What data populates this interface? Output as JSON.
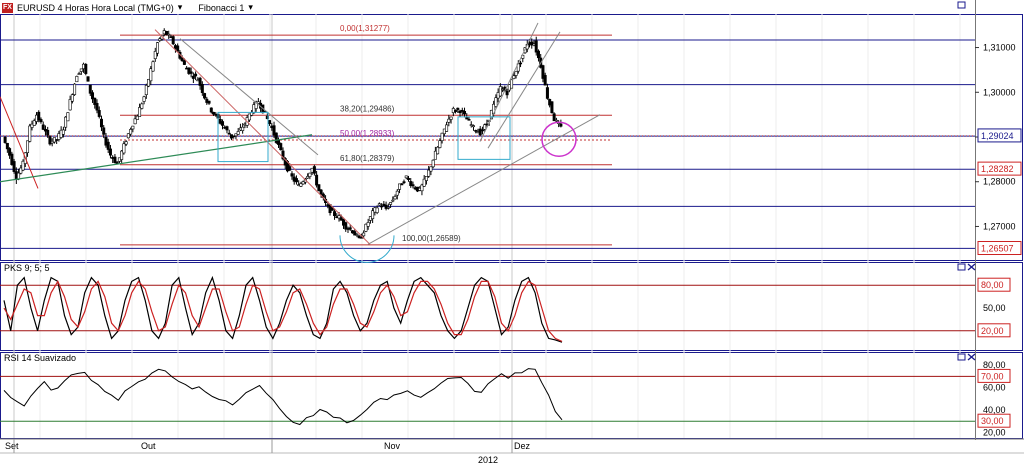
{
  "header": {
    "app_icon": "fx-icon",
    "icon_text": "FX",
    "symbol_title": "EURUSD 4 Horas Hora Local (TMG+0)",
    "fib_label": "Fibonacci 1"
  },
  "colors": {
    "candle_up": "#000000",
    "candle_down": "#000000",
    "fib_level_line": "#c03030",
    "blue_lines": "#1a1a8c",
    "green_trend": "#2e8b57",
    "magenta_circle": "#cc33cc",
    "cyan_box": "#33aacc",
    "stoch_k": "#000000",
    "stoch_d": "#cc2222",
    "rsi_line": "#000000",
    "price_tag_bg": "#cc2222",
    "price_tag_text": "#ffffff",
    "rsi_70": "#a01010",
    "rsi_30": "#2e7d32"
  },
  "chart_data": [
    {
      "type": "line",
      "panel": "price",
      "title": "EURUSD 4 Horas Hora Local (TMG+0)",
      "y_ticks": [
        "1,31000",
        "1,30000",
        "1,29000",
        "1,28000",
        "1,27000"
      ],
      "y_tick_values": [
        1.31,
        1.3,
        1.29,
        1.28,
        1.27
      ],
      "ylim": [
        1.2625,
        1.3175
      ],
      "price_tags": [
        {
          "label": "1,29024",
          "value": 1.29024,
          "style": "current"
        },
        {
          "label": "1,28282",
          "value": 1.28282,
          "style": "support"
        },
        {
          "label": "1,26507",
          "value": 1.26507,
          "style": "support"
        }
      ],
      "fibonacci": [
        {
          "label": "0,00(1,31277)",
          "value": 1.31277
        },
        {
          "label": "38,20(1,29486)",
          "value": 1.29486
        },
        {
          "label": "50,00(1,28933)",
          "value": 1.28933
        },
        {
          "label": "61,80(1,28379)",
          "value": 1.28379
        },
        {
          "label": "100,00(1,26589)",
          "value": 1.26589
        }
      ],
      "horizontal_lines": [
        1.3117,
        1.3017,
        1.2902,
        1.2828,
        1.2745,
        1.2651
      ],
      "close_series": [
        1.29,
        1.286,
        1.281,
        1.284,
        1.292,
        1.295,
        1.292,
        1.289,
        1.2895,
        1.292,
        1.298,
        1.304,
        1.306,
        1.3,
        1.296,
        1.29,
        1.286,
        1.284,
        1.288,
        1.292,
        1.295,
        1.299,
        1.305,
        1.311,
        1.3135,
        1.312,
        1.309,
        1.306,
        1.304,
        1.303,
        1.299,
        1.296,
        1.294,
        1.292,
        1.29,
        1.291,
        1.293,
        1.296,
        1.298,
        1.295,
        1.292,
        1.288,
        1.284,
        1.281,
        1.279,
        1.281,
        1.283,
        1.278,
        1.275,
        1.273,
        1.272,
        1.27,
        1.269,
        1.267,
        1.27,
        1.273,
        1.275,
        1.274,
        1.276,
        1.279,
        1.281,
        1.279,
        1.278,
        1.281,
        1.285,
        1.289,
        1.293,
        1.296,
        1.296,
        1.294,
        1.292,
        1.291,
        1.293,
        1.297,
        1.301,
        1.3,
        1.304,
        1.307,
        1.311,
        1.311,
        1.306,
        1.299,
        1.294,
        1.292
      ]
    },
    {
      "type": "line",
      "panel": "stochastic",
      "title": "PKS 9; 5; 5",
      "y_ticks": [
        "80,00",
        "50,00",
        "20,00"
      ],
      "y_tick_values": [
        80,
        50,
        20
      ],
      "levels": [
        {
          "label": "80,00",
          "value": 80
        },
        {
          "label": "20,00",
          "value": 20
        }
      ],
      "ylim": [
        0,
        100
      ],
      "series": [
        {
          "values": [
            60,
            20,
            80,
            90,
            50,
            20,
            60,
            90,
            85,
            40,
            15,
            25,
            70,
            90,
            80,
            40,
            10,
            20,
            60,
            85,
            90,
            60,
            20,
            10,
            30,
            80,
            90,
            50,
            15,
            30,
            70,
            90,
            60,
            20,
            10,
            40,
            80,
            90,
            60,
            25,
            10,
            30,
            60,
            80,
            70,
            40,
            15,
            10,
            30,
            75,
            85,
            70,
            40,
            20,
            30,
            60,
            80,
            85,
            50,
            30,
            60,
            85,
            90,
            80,
            70,
            40,
            20,
            10,
            20,
            50,
            80,
            90,
            85,
            50,
            15,
            25,
            60,
            85,
            90,
            70,
            30,
            10,
            8,
            5
          ]
        },
        {
          "values": [
            50,
            35,
            55,
            75,
            70,
            40,
            40,
            70,
            85,
            65,
            35,
            25,
            45,
            75,
            85,
            65,
            30,
            20,
            40,
            70,
            85,
            75,
            45,
            20,
            25,
            55,
            80,
            70,
            40,
            25,
            50,
            75,
            75,
            45,
            20,
            25,
            55,
            80,
            75,
            45,
            20,
            25,
            45,
            70,
            75,
            55,
            30,
            15,
            25,
            55,
            75,
            75,
            55,
            30,
            25,
            45,
            70,
            80,
            65,
            40,
            45,
            70,
            85,
            85,
            75,
            55,
            30,
            15,
            15,
            35,
            65,
            85,
            85,
            65,
            30,
            20,
            40,
            70,
            85,
            80,
            50,
            20,
            10,
            6
          ]
        }
      ]
    },
    {
      "type": "line",
      "panel": "rsi",
      "title": "RSI 14 Suavizado",
      "y_ticks": [
        "80,00",
        "70,00",
        "60,00",
        "40,00",
        "30,00",
        "20,00"
      ],
      "y_tick_values": [
        80,
        70,
        60,
        40,
        30,
        20
      ],
      "levels": [
        {
          "label": "70,00",
          "value": 70
        },
        {
          "label": "30,00",
          "value": 30
        }
      ],
      "ylim": [
        15,
        90
      ],
      "series": [
        {
          "values": [
            58,
            52,
            46,
            44,
            52,
            60,
            64,
            58,
            60,
            66,
            70,
            72,
            74,
            66,
            62,
            58,
            52,
            48,
            56,
            62,
            66,
            68,
            72,
            76,
            74,
            70,
            66,
            62,
            60,
            60,
            56,
            52,
            50,
            48,
            46,
            50,
            56,
            60,
            62,
            56,
            48,
            40,
            34,
            30,
            28,
            32,
            36,
            40,
            38,
            34,
            32,
            30,
            32,
            34,
            40,
            46,
            50,
            48,
            52,
            56,
            58,
            52,
            50,
            54,
            60,
            64,
            68,
            70,
            70,
            64,
            58,
            56,
            62,
            68,
            72,
            68,
            72,
            74,
            76,
            76,
            64,
            52,
            40,
            32
          ]
        }
      ]
    }
  ],
  "time_axis": {
    "labels": [
      "Set",
      "Out",
      "Nov",
      "Dez"
    ],
    "year_label": "2012"
  },
  "panel_controls": {
    "restore_icon": "restore-icon",
    "close_icon": "close-icon"
  }
}
